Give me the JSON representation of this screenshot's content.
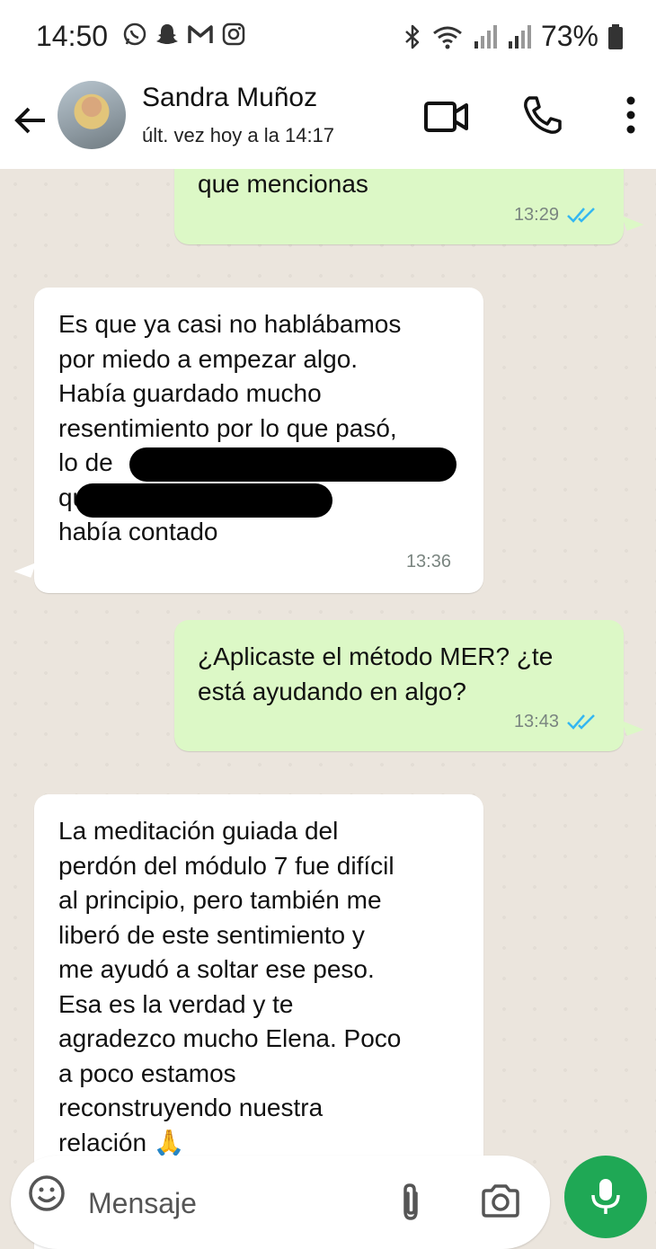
{
  "status_bar": {
    "time": "14:50",
    "battery": "73%",
    "app_icons": [
      "whatsapp-icon",
      "snapchat-icon",
      "gmail-icon",
      "instagram-icon"
    ],
    "system_icons": [
      "bluetooth-icon",
      "wifi-icon",
      "signal-icon",
      "signal-icon",
      "battery-icon"
    ]
  },
  "header": {
    "contact_name": "Sandra Muñoz",
    "last_seen": "últ. vez hoy a la 14:17",
    "icons": [
      "back-arrow-icon",
      "video-call-icon",
      "voice-call-icon",
      "more-options-icon"
    ]
  },
  "messages": [
    {
      "direction": "outgoing",
      "text": "que mencionas",
      "time": "13:29",
      "read": true
    },
    {
      "direction": "incoming",
      "text": "Es que ya casi no hablábamos\npor miedo a empezar algo.\nHabía guardado mucho\nresentimiento por lo que pasó,\nlo de\n que te\nhabía contado",
      "time": "13:36",
      "redacted": true
    },
    {
      "direction": "outgoing",
      "text": "¿Aplicaste el método MER? ¿te\nestá ayudando en algo?",
      "time": "13:43",
      "read": true
    },
    {
      "direction": "incoming",
      "text": "La meditación guiada del\nperdón del módulo 7 fue difícil\nal principio, pero también me\nliberó de este sentimiento y\nme ayudó a soltar ese peso.\nEsa es la verdad y te\nagradezco mucho Elena. Poco\na poco estamos\nreconstruyendo nuestra\nrelación 🙏"
    }
  ],
  "input": {
    "placeholder": "Mensaje",
    "icons": [
      "emoji-icon",
      "attach-icon",
      "camera-icon",
      "mic-icon"
    ]
  },
  "colors": {
    "outgoing_bubble": "#dcf8c6",
    "incoming_bubble": "#ffffff",
    "read_ticks": "#34b7f1",
    "mic_button": "#1fa855"
  }
}
